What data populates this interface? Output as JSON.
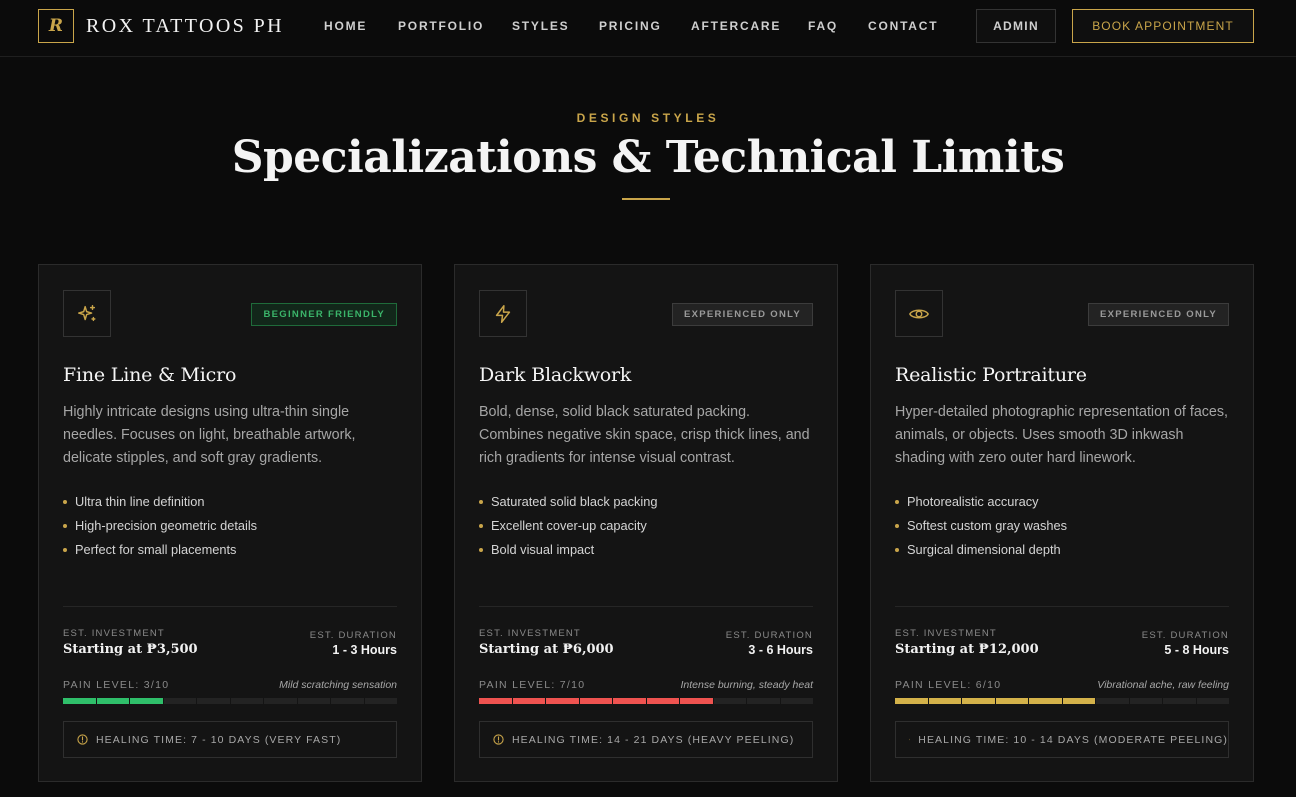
{
  "brand": {
    "logo_letter": "R",
    "name": "ROX TATTOOS PH"
  },
  "nav": {
    "links": [
      "HOME",
      "PORTFOLIO",
      "STYLES",
      "PRICING",
      "AFTERCARE",
      "FAQ",
      "CONTACT"
    ],
    "admin_label": "ADMIN",
    "book_label": "BOOK APPOINTMENT"
  },
  "section": {
    "eyebrow": "DESIGN STYLES",
    "title": "Specializations & Technical Limits"
  },
  "labels": {
    "investment": "EST. INVESTMENT",
    "duration": "EST. DURATION"
  },
  "colors": {
    "accent": "#c9a54a",
    "green": "#2fbf6a",
    "red": "#ef5350",
    "gold": "#d4b24a"
  },
  "cards": [
    {
      "icon": "sparkles-icon",
      "badge": "BEGINNER FRIENDLY",
      "title": "Fine Line & Micro",
      "description": "Highly intricate designs using ultra-thin single needles. Focuses on light, breathable artwork, delicate stipples, and soft gray gradients.",
      "features": [
        "Ultra thin line definition",
        "High-precision geometric details",
        "Perfect for small placements"
      ],
      "price": "Starting at ₱3,500",
      "duration": "1 - 3 Hours",
      "pain_label": "PAIN LEVEL: 3/10",
      "pain_value": 3,
      "pain_note": "Mild scratching sensation",
      "healing": "HEALING TIME: 7 - 10 DAYS (VERY FAST)"
    },
    {
      "icon": "lightning-icon",
      "badge": "EXPERIENCED ONLY",
      "title": "Dark Blackwork",
      "description": "Bold, dense, solid black saturated packing. Combines negative skin space, crisp thick lines, and rich gradients for intense visual contrast.",
      "features": [
        "Saturated solid black packing",
        "Excellent cover-up capacity",
        "Bold visual impact"
      ],
      "price": "Starting at ₱6,000",
      "duration": "3 - 6 Hours",
      "pain_label": "PAIN LEVEL: 7/10",
      "pain_value": 7,
      "pain_note": "Intense burning, steady heat",
      "healing": "HEALING TIME: 14 - 21 DAYS (HEAVY PEELING)"
    },
    {
      "icon": "eye-icon",
      "badge": "EXPERIENCED ONLY",
      "title": "Realistic Portraiture",
      "description": "Hyper-detailed photographic representation of faces, animals, or objects. Uses smooth 3D inkwash shading with zero outer hard linework.",
      "features": [
        "Photorealistic accuracy",
        "Softest custom gray washes",
        "Surgical dimensional depth"
      ],
      "price": "Starting at ₱12,000",
      "duration": "5 - 8 Hours",
      "pain_label": "PAIN LEVEL: 6/10",
      "pain_value": 6,
      "pain_note": "Vibrational ache, raw feeling",
      "healing": "HEALING TIME: 10 - 14 DAYS (MODERATE PEELING)"
    }
  ]
}
